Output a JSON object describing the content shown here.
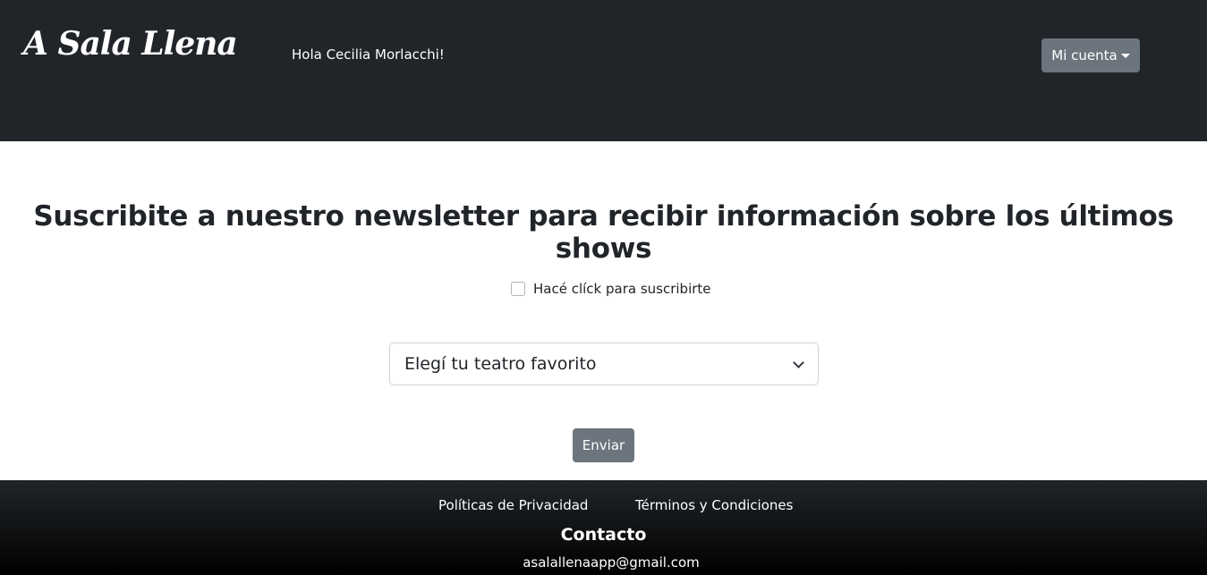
{
  "navbar": {
    "brand": "A Sala Llena",
    "greeting": "Hola Cecilia Morlacchi!",
    "account_button": "Mi cuenta",
    "account_icon": "caret-down-icon"
  },
  "newsletter": {
    "headline": "Suscribite a nuestro newsletter para recibir información sobre los últimos shows",
    "checkbox_label": "Hacé clíck para suscribirte",
    "checkbox_checked": false,
    "select_value": "Elegí tu teatro favorito",
    "select_icon": "chevron-down-icon",
    "submit_label": "Enviar"
  },
  "footer": {
    "privacy_link": "Políticas de Privacidad",
    "terms_link": "Términos y Condiciones",
    "contact_title": "Contacto",
    "contact_email": "asalallenaapp@gmail.com"
  },
  "colors": {
    "navbar_bg": "#212529",
    "button_bg": "#6c757d",
    "footer_bg": "#000000"
  }
}
